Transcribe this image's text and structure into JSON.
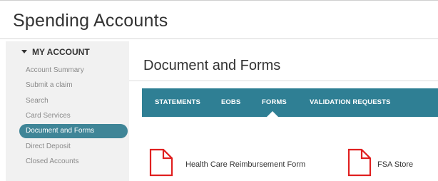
{
  "header": {
    "title": "Spending Accounts"
  },
  "sidebar": {
    "section_label": "MY ACCOUNT",
    "items": [
      {
        "label": "Account Summary"
      },
      {
        "label": "Submit a claim"
      },
      {
        "label": "Search"
      },
      {
        "label": "Card Services"
      },
      {
        "label": "Document and Forms",
        "active": true
      },
      {
        "label": "Direct Deposit"
      },
      {
        "label": "Closed Accounts"
      }
    ]
  },
  "main": {
    "title": "Document and Forms",
    "tabs": [
      {
        "label": "STATEMENTS"
      },
      {
        "label": "EOBS"
      },
      {
        "label": "FORMS",
        "active": true
      },
      {
        "label": "VALIDATION REQUESTS"
      }
    ],
    "forms": [
      {
        "label": "Health Care Reimbursement Form",
        "icon": "document-icon"
      },
      {
        "label": "FSA Store",
        "icon": "document-icon"
      }
    ]
  },
  "colors": {
    "accent": "#2f7f94",
    "active_nav": "#3f8597",
    "icon": "#e02020"
  }
}
